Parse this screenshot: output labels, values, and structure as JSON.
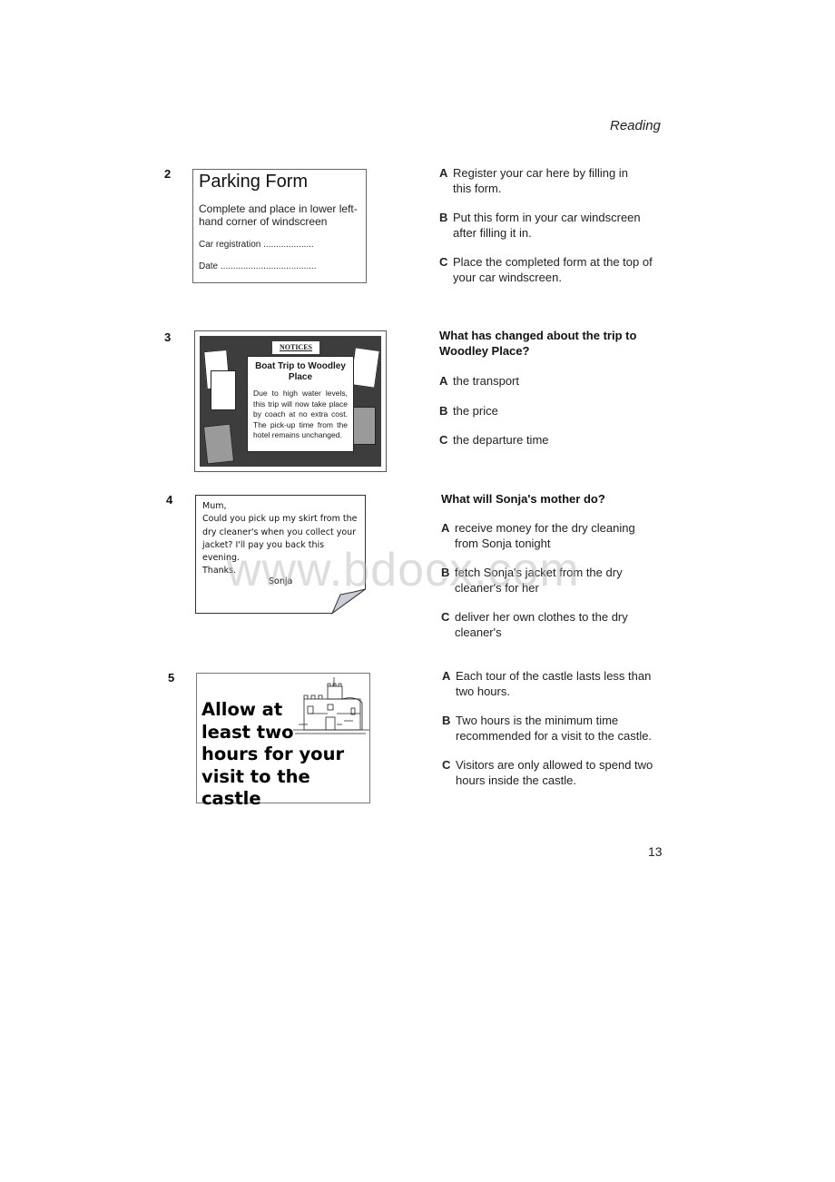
{
  "header": {
    "section": "Reading"
  },
  "page_number": "13",
  "watermark": "www.bdocx.com",
  "questions": [
    {
      "number": "2",
      "notice": {
        "title": "Parking Form",
        "instruction": "Complete and place in lower left-hand corner of windscreen",
        "field_car": "Car registration ....................",
        "field_date": "Date ......................................"
      },
      "question": "",
      "options": [
        {
          "letter": "A",
          "text": "Register your car here by filling in this form."
        },
        {
          "letter": "B",
          "text": "Put this form in your car windscreen after filling it in."
        },
        {
          "letter": "C",
          "text": "Place the completed form at the top of your car windscreen."
        }
      ]
    },
    {
      "number": "3",
      "notice": {
        "board_label": "NOTICES",
        "title": "Boat Trip to Woodley Place",
        "body": "Due to high water levels, this trip will now take place by coach at no extra cost. The pick-up time from the hotel remains unchanged."
      },
      "question": "What has changed about the trip to Woodley Place?",
      "options": [
        {
          "letter": "A",
          "text": "the transport"
        },
        {
          "letter": "B",
          "text": "the price"
        },
        {
          "letter": "C",
          "text": "the departure time"
        }
      ]
    },
    {
      "number": "4",
      "notice": {
        "body": "Mum,\nCould you pick up my skirt from the\ndry cleaner's when you collect your\njacket? I'll pay you back this\nevening.\nThanks.",
        "signature": "Sonja"
      },
      "question": "What will Sonja's mother do?",
      "options": [
        {
          "letter": "A",
          "text": "receive money for the dry cleaning from Sonja tonight"
        },
        {
          "letter": "B",
          "text": "fetch Sonja's jacket from the dry cleaner's for her"
        },
        {
          "letter": "C",
          "text": "deliver her own clothes to the dry cleaner's"
        }
      ]
    },
    {
      "number": "5",
      "notice": {
        "body": "Allow at\nleast two\nhours for your\nvisit to the castle",
        "image": "castle-illustration"
      },
      "question": "",
      "options": [
        {
          "letter": "A",
          "text": "Each tour of the castle lasts less than two hours."
        },
        {
          "letter": "B",
          "text": "Two hours is the minimum time recommended for a visit to the castle."
        },
        {
          "letter": "C",
          "text": "Visitors are only allowed to spend two hours inside the castle."
        }
      ]
    }
  ]
}
